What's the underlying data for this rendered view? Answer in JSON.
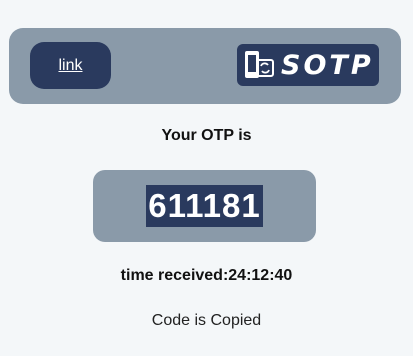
{
  "header": {
    "link_label": "link",
    "logo_text": "SOTP",
    "logo_icon": "phone-sync-icon"
  },
  "otp": {
    "label": "Your OTP is",
    "code": "611181",
    "time_received": "time received:24:12:40",
    "status": "Code is Copied"
  },
  "colors": {
    "background": "#f4f7f9",
    "panel": "#8a9aa9",
    "accent": "#2a3a5e"
  }
}
